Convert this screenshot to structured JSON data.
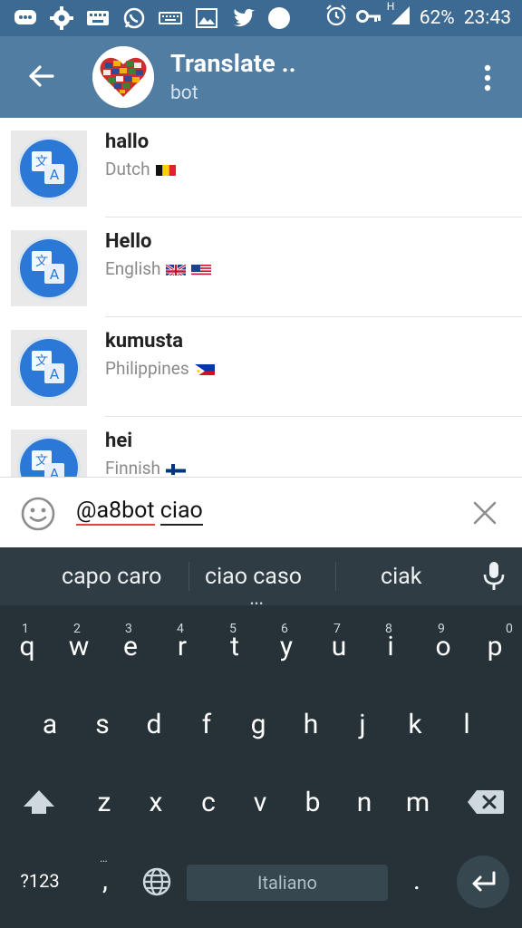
{
  "status_bar": {
    "battery_pct": "62%",
    "time": "23:43",
    "network": "H"
  },
  "app_bar": {
    "title": "Translate ..",
    "subtitle": "bot"
  },
  "results": [
    {
      "word": "hallo",
      "language": "Dutch",
      "flags": [
        "be"
      ]
    },
    {
      "word": "Hello",
      "language": "English",
      "flags": [
        "gb",
        "us"
      ]
    },
    {
      "word": "kumusta",
      "language": "Philippines",
      "flags": [
        "ph"
      ]
    },
    {
      "word": "hei",
      "language": "Finnish",
      "flags": [
        "fi"
      ]
    }
  ],
  "input": {
    "mention": "@a8bot",
    "query": "ciao"
  },
  "keyboard": {
    "suggestions": [
      "capo caro",
      "ciao caso",
      "ciak"
    ],
    "row1": [
      {
        "k": "q",
        "n": "1"
      },
      {
        "k": "w",
        "n": "2"
      },
      {
        "k": "e",
        "n": "3"
      },
      {
        "k": "r",
        "n": "4"
      },
      {
        "k": "t",
        "n": "5"
      },
      {
        "k": "y",
        "n": "6"
      },
      {
        "k": "u",
        "n": "7"
      },
      {
        "k": "i",
        "n": "8"
      },
      {
        "k": "o",
        "n": "9"
      },
      {
        "k": "p",
        "n": "0"
      }
    ],
    "row2": [
      "a",
      "s",
      "d",
      "f",
      "g",
      "h",
      "j",
      "k",
      "l"
    ],
    "row3": [
      "z",
      "x",
      "c",
      "v",
      "b",
      "n",
      "m"
    ],
    "symbols_label": "?123",
    "comma": ",",
    "period": ".",
    "space_label": "Italiano"
  }
}
